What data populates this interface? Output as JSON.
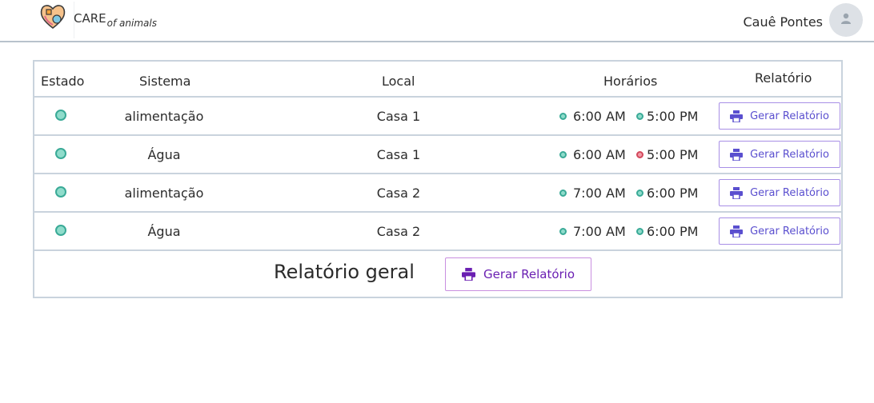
{
  "header": {
    "brand_main": "CARE",
    "brand_sub": "of animals",
    "user_name": "Cauê Pontes",
    "logo_icon": "heart-hands-icon",
    "avatar_icon": "person-icon"
  },
  "table": {
    "columns": {
      "estado": "Estado",
      "sistema": "Sistema",
      "local": "Local",
      "horarios": "Horários",
      "relatorio": "Relatório"
    },
    "rows": [
      {
        "sistema": "alimentação",
        "local": "Casa 1",
        "time1": "6:00 AM",
        "time2": "5:00 PM",
        "time1_status": "ok",
        "time2_status": "ok",
        "button": "Gerar Relatório"
      },
      {
        "sistema": "Água",
        "local": "Casa 1",
        "time1": "6:00 AM",
        "time2": "5:00 PM",
        "time1_status": "ok",
        "time2_status": "bad",
        "button": "Gerar Relatório"
      },
      {
        "sistema": "alimentação",
        "local": "Casa 2",
        "time1": "7:00 AM",
        "time2": "6:00 PM",
        "time1_status": "ok",
        "time2_status": "ok",
        "button": "Gerar Relatório"
      },
      {
        "sistema": "Água",
        "local": "Casa 2",
        "time1": "7:00 AM",
        "time2": "6:00 PM",
        "time1_status": "ok",
        "time2_status": "ok",
        "button": "Gerar Relatório"
      }
    ],
    "status_colors": {
      "ok": "#3aaa97",
      "bad": "#d3485c"
    }
  },
  "footer": {
    "label": "Relatório geral",
    "button": "Gerar Relatório",
    "print_icon": "printer-icon"
  }
}
